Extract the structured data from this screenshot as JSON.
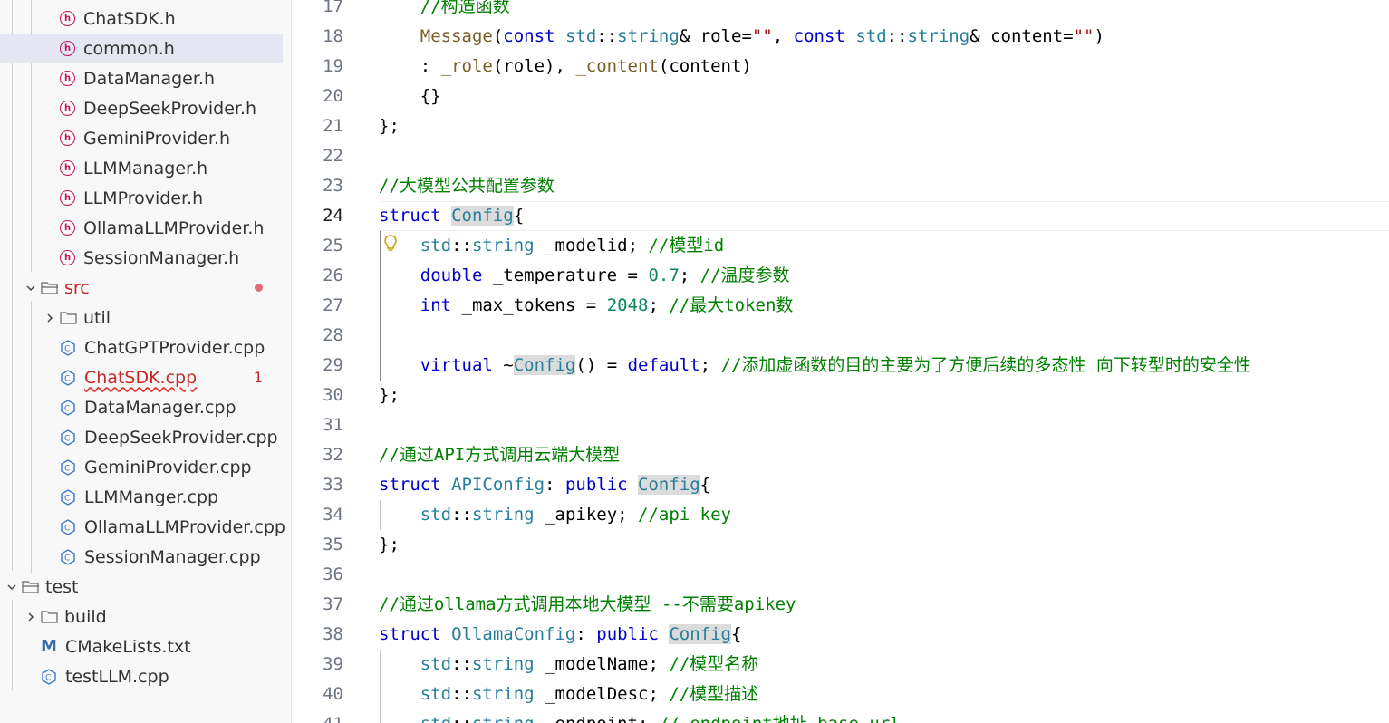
{
  "explorer": {
    "items": [
      {
        "name": "ChatSDK.h",
        "type": "header"
      },
      {
        "name": "common.h",
        "type": "header",
        "selected": true
      },
      {
        "name": "DataManager.h",
        "type": "header"
      },
      {
        "name": "DeepSeekProvider.h",
        "type": "header"
      },
      {
        "name": "GeminiProvider.h",
        "type": "header"
      },
      {
        "name": "LLMManager.h",
        "type": "header"
      },
      {
        "name": "LLMProvider.h",
        "type": "header"
      },
      {
        "name": "OllamaLLMProvider.h",
        "type": "header"
      },
      {
        "name": "SessionManager.h",
        "type": "header"
      },
      {
        "name": "src",
        "type": "folder-open"
      },
      {
        "name": "util",
        "type": "folder-closed"
      },
      {
        "name": "ChatGPTProvider.cpp",
        "type": "cpp"
      },
      {
        "name": "ChatSDK.cpp",
        "type": "cpp",
        "error_count": "1"
      },
      {
        "name": "DataManager.cpp",
        "type": "cpp"
      },
      {
        "name": "DeepSeekProvider.cpp",
        "type": "cpp"
      },
      {
        "name": "GeminiProvider.cpp",
        "type": "cpp"
      },
      {
        "name": "LLMManger.cpp",
        "type": "cpp"
      },
      {
        "name": "OllamaLLMProvider.cpp",
        "type": "cpp"
      },
      {
        "name": "SessionManager.cpp",
        "type": "cpp"
      },
      {
        "name": "test",
        "type": "folder-open"
      },
      {
        "name": "build",
        "type": "folder-closed"
      },
      {
        "name": "CMakeLists.txt",
        "type": "cmake"
      },
      {
        "name": "testLLM.cpp",
        "type": "cpp"
      }
    ]
  },
  "editor": {
    "active_line": "24",
    "lines": [
      {
        "n": "17",
        "code": "    //构造函数"
      },
      {
        "n": "18",
        "code": "    Message(const std::string& role=\"\", const std::string& content=\"\")"
      },
      {
        "n": "19",
        "code": "    : _role(role), _content(content)"
      },
      {
        "n": "20",
        "code": "    {}"
      },
      {
        "n": "21",
        "code": "};"
      },
      {
        "n": "22",
        "code": ""
      },
      {
        "n": "23",
        "code": "//大模型公共配置参数"
      },
      {
        "n": "24",
        "code": "struct Config{"
      },
      {
        "n": "25",
        "code": "    std::string _modelid; //模型id"
      },
      {
        "n": "26",
        "code": "    double _temperature = 0.7; //温度参数"
      },
      {
        "n": "27",
        "code": "    int _max_tokens = 2048; //最大token数"
      },
      {
        "n": "28",
        "code": ""
      },
      {
        "n": "29",
        "code": "    virtual ~Config() = default; //添加虚函数的目的主要为了方便后续的多态性 向下转型时的安全性"
      },
      {
        "n": "30",
        "code": "};"
      },
      {
        "n": "31",
        "code": ""
      },
      {
        "n": "32",
        "code": "//通过API方式调用云端大模型"
      },
      {
        "n": "33",
        "code": "struct APIConfig: public Config{"
      },
      {
        "n": "34",
        "code": "    std::string _apikey; //api key"
      },
      {
        "n": "35",
        "code": "};"
      },
      {
        "n": "36",
        "code": ""
      },
      {
        "n": "37",
        "code": "//通过ollama方式调用本地大模型 --不需要apikey"
      },
      {
        "n": "38",
        "code": "struct OllamaConfig: public Config{"
      },
      {
        "n": "39",
        "code": "    std::string _modelName; //模型名称"
      },
      {
        "n": "40",
        "code": "    std::string _modelDesc; //模型描述"
      },
      {
        "n": "41",
        "code": "    std::string _endpoint; // endpoint地址 base url"
      }
    ]
  },
  "colors": {
    "keyword": "#0000cc",
    "type": "#267f99",
    "comment": "#008000",
    "string": "#a31515",
    "number": "#098658",
    "function": "#795e26",
    "header_icon": "#c2185b",
    "error": "#c62828"
  }
}
